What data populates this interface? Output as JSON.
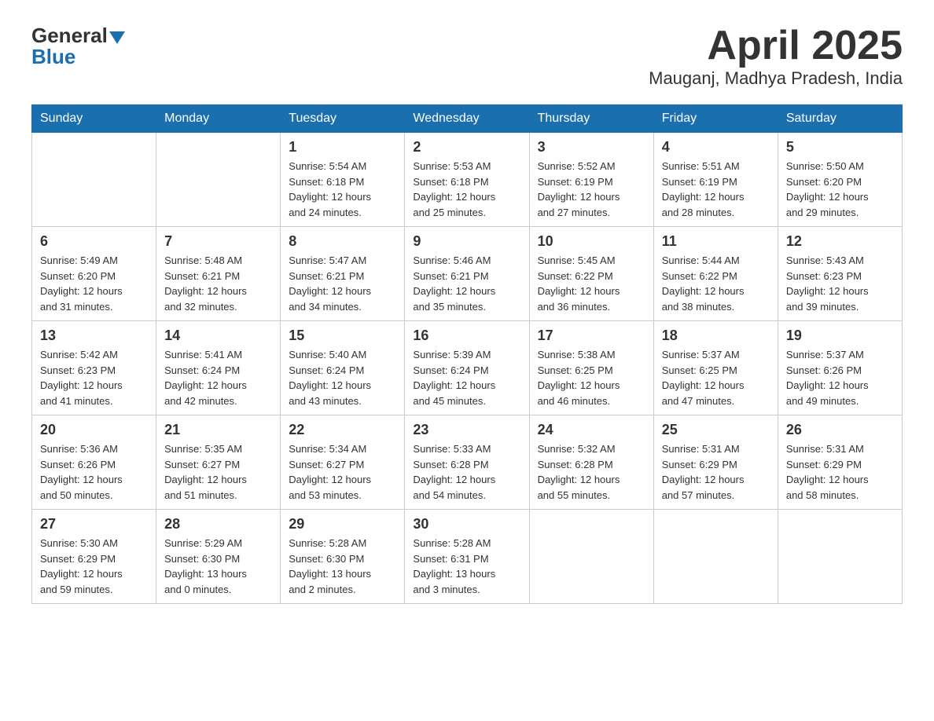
{
  "header": {
    "logo_general": "General",
    "logo_blue": "Blue",
    "month_title": "April 2025",
    "location": "Mauganj, Madhya Pradesh, India"
  },
  "days_of_week": [
    "Sunday",
    "Monday",
    "Tuesday",
    "Wednesday",
    "Thursday",
    "Friday",
    "Saturday"
  ],
  "weeks": [
    [
      {
        "day": "",
        "info": ""
      },
      {
        "day": "",
        "info": ""
      },
      {
        "day": "1",
        "info": "Sunrise: 5:54 AM\nSunset: 6:18 PM\nDaylight: 12 hours\nand 24 minutes."
      },
      {
        "day": "2",
        "info": "Sunrise: 5:53 AM\nSunset: 6:18 PM\nDaylight: 12 hours\nand 25 minutes."
      },
      {
        "day": "3",
        "info": "Sunrise: 5:52 AM\nSunset: 6:19 PM\nDaylight: 12 hours\nand 27 minutes."
      },
      {
        "day": "4",
        "info": "Sunrise: 5:51 AM\nSunset: 6:19 PM\nDaylight: 12 hours\nand 28 minutes."
      },
      {
        "day": "5",
        "info": "Sunrise: 5:50 AM\nSunset: 6:20 PM\nDaylight: 12 hours\nand 29 minutes."
      }
    ],
    [
      {
        "day": "6",
        "info": "Sunrise: 5:49 AM\nSunset: 6:20 PM\nDaylight: 12 hours\nand 31 minutes."
      },
      {
        "day": "7",
        "info": "Sunrise: 5:48 AM\nSunset: 6:21 PM\nDaylight: 12 hours\nand 32 minutes."
      },
      {
        "day": "8",
        "info": "Sunrise: 5:47 AM\nSunset: 6:21 PM\nDaylight: 12 hours\nand 34 minutes."
      },
      {
        "day": "9",
        "info": "Sunrise: 5:46 AM\nSunset: 6:21 PM\nDaylight: 12 hours\nand 35 minutes."
      },
      {
        "day": "10",
        "info": "Sunrise: 5:45 AM\nSunset: 6:22 PM\nDaylight: 12 hours\nand 36 minutes."
      },
      {
        "day": "11",
        "info": "Sunrise: 5:44 AM\nSunset: 6:22 PM\nDaylight: 12 hours\nand 38 minutes."
      },
      {
        "day": "12",
        "info": "Sunrise: 5:43 AM\nSunset: 6:23 PM\nDaylight: 12 hours\nand 39 minutes."
      }
    ],
    [
      {
        "day": "13",
        "info": "Sunrise: 5:42 AM\nSunset: 6:23 PM\nDaylight: 12 hours\nand 41 minutes."
      },
      {
        "day": "14",
        "info": "Sunrise: 5:41 AM\nSunset: 6:24 PM\nDaylight: 12 hours\nand 42 minutes."
      },
      {
        "day": "15",
        "info": "Sunrise: 5:40 AM\nSunset: 6:24 PM\nDaylight: 12 hours\nand 43 minutes."
      },
      {
        "day": "16",
        "info": "Sunrise: 5:39 AM\nSunset: 6:24 PM\nDaylight: 12 hours\nand 45 minutes."
      },
      {
        "day": "17",
        "info": "Sunrise: 5:38 AM\nSunset: 6:25 PM\nDaylight: 12 hours\nand 46 minutes."
      },
      {
        "day": "18",
        "info": "Sunrise: 5:37 AM\nSunset: 6:25 PM\nDaylight: 12 hours\nand 47 minutes."
      },
      {
        "day": "19",
        "info": "Sunrise: 5:37 AM\nSunset: 6:26 PM\nDaylight: 12 hours\nand 49 minutes."
      }
    ],
    [
      {
        "day": "20",
        "info": "Sunrise: 5:36 AM\nSunset: 6:26 PM\nDaylight: 12 hours\nand 50 minutes."
      },
      {
        "day": "21",
        "info": "Sunrise: 5:35 AM\nSunset: 6:27 PM\nDaylight: 12 hours\nand 51 minutes."
      },
      {
        "day": "22",
        "info": "Sunrise: 5:34 AM\nSunset: 6:27 PM\nDaylight: 12 hours\nand 53 minutes."
      },
      {
        "day": "23",
        "info": "Sunrise: 5:33 AM\nSunset: 6:28 PM\nDaylight: 12 hours\nand 54 minutes."
      },
      {
        "day": "24",
        "info": "Sunrise: 5:32 AM\nSunset: 6:28 PM\nDaylight: 12 hours\nand 55 minutes."
      },
      {
        "day": "25",
        "info": "Sunrise: 5:31 AM\nSunset: 6:29 PM\nDaylight: 12 hours\nand 57 minutes."
      },
      {
        "day": "26",
        "info": "Sunrise: 5:31 AM\nSunset: 6:29 PM\nDaylight: 12 hours\nand 58 minutes."
      }
    ],
    [
      {
        "day": "27",
        "info": "Sunrise: 5:30 AM\nSunset: 6:29 PM\nDaylight: 12 hours\nand 59 minutes."
      },
      {
        "day": "28",
        "info": "Sunrise: 5:29 AM\nSunset: 6:30 PM\nDaylight: 13 hours\nand 0 minutes."
      },
      {
        "day": "29",
        "info": "Sunrise: 5:28 AM\nSunset: 6:30 PM\nDaylight: 13 hours\nand 2 minutes."
      },
      {
        "day": "30",
        "info": "Sunrise: 5:28 AM\nSunset: 6:31 PM\nDaylight: 13 hours\nand 3 minutes."
      },
      {
        "day": "",
        "info": ""
      },
      {
        "day": "",
        "info": ""
      },
      {
        "day": "",
        "info": ""
      }
    ]
  ]
}
